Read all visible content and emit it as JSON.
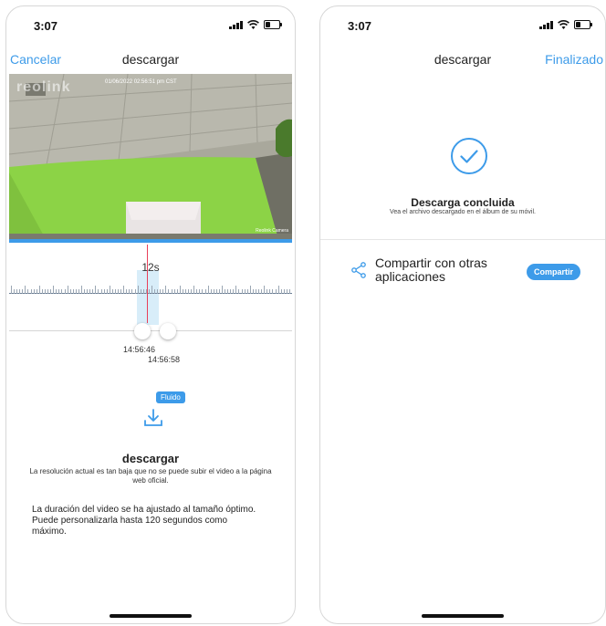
{
  "left": {
    "status_time": "3:07",
    "nav": {
      "cancel": "Cancelar",
      "title": "descargar"
    },
    "video": {
      "watermark": "reolink",
      "timestamp": "01/06/2022 02:56:51 pm CST",
      "camera": "Reolink Camera"
    },
    "timeline": {
      "duration": "12s",
      "start_time": "14:56:46",
      "end_time": "14:56:58"
    },
    "quality_badge": "Fluido",
    "download": {
      "title": "descargar",
      "note": "La resolución actual es tan baja que no se puede subir el video a la página web oficial.",
      "description": "La duración del video se ha ajustado al tamaño óptimo. Puede personalizarla hasta 120 segundos como máximo."
    }
  },
  "right": {
    "status_time": "3:07",
    "nav": {
      "title": "descargar",
      "done": "Finalizado"
    },
    "done": {
      "title": "Descarga concluida",
      "subtitle": "Vea el archivo descargado en el álbum de su móvil."
    },
    "share": {
      "label": "Compartir con otras aplicaciones",
      "button": "Compartir"
    }
  },
  "colors": {
    "accent": "#3d9be9",
    "cursor": "#e8405a",
    "wall": "#8cd346"
  },
  "icons": [
    "signal-icon",
    "wifi-icon",
    "battery-icon",
    "download-icon",
    "checkmark-circle-icon",
    "share-icon"
  ]
}
